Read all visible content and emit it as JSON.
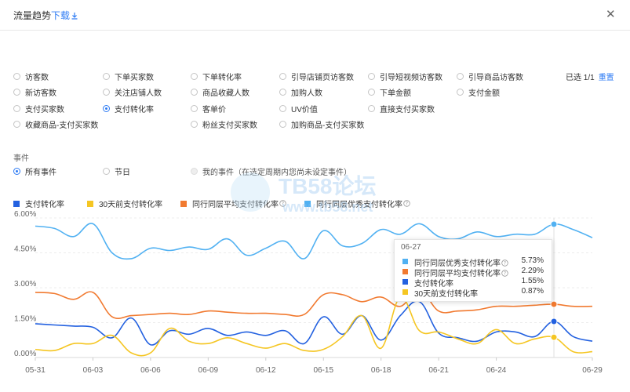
{
  "header": {
    "title": "流量趋势",
    "link": "下载",
    "download_icon": "download-icon",
    "close_icon": "close-icon"
  },
  "metrics": {
    "rows": [
      [
        {
          "label": "访客数",
          "checked": false
        },
        {
          "label": "下单买家数",
          "checked": false
        },
        {
          "label": "下单转化率",
          "checked": false
        },
        {
          "label": "引导店铺页访客数",
          "checked": false
        },
        {
          "label": "引导短视频访客数",
          "checked": false
        },
        {
          "label": "引导商品访客数",
          "checked": false
        }
      ],
      [
        {
          "label": "新访客数",
          "checked": false
        },
        {
          "label": "关注店铺人数",
          "checked": false
        },
        {
          "label": "商品收藏人数",
          "checked": false
        },
        {
          "label": "加购人数",
          "checked": false
        },
        {
          "label": "下单金额",
          "checked": false
        },
        {
          "label": "支付金额",
          "checked": false
        }
      ],
      [
        {
          "label": "支付买家数",
          "checked": false
        },
        {
          "label": "支付转化率",
          "checked": true
        },
        {
          "label": "客单价",
          "checked": false
        },
        {
          "label": "UV价值",
          "checked": false
        },
        {
          "label": "直接支付买家数",
          "checked": false
        }
      ],
      [
        {
          "label": "收藏商品-支付买家数",
          "checked": false
        },
        null,
        {
          "label": "粉丝支付买家数",
          "checked": false
        },
        {
          "label": "加购商品-支付买家数",
          "checked": false
        }
      ]
    ],
    "selected_text": "已选 1/1",
    "reset": "重置"
  },
  "events": {
    "title": "事件",
    "options": [
      {
        "label": "所有事件",
        "checked": true
      },
      {
        "label": "节日",
        "checked": false
      },
      {
        "label": "我的事件（在选定周期内您尚未设定事件）",
        "checked": false,
        "disabled": true
      }
    ]
  },
  "legend": [
    {
      "name": "支付转化率",
      "color": "#2361e0"
    },
    {
      "name": "30天前支付转化率",
      "color": "#f5c623"
    },
    {
      "name": "同行同层平均支付转化率",
      "color": "#f17a30",
      "help_icon": "help-icon"
    },
    {
      "name": "同行同层优秀支付转化率",
      "color": "#51b1f2",
      "help_icon": "help-icon"
    }
  ],
  "tooltip": {
    "date": "06-27",
    "rows": [
      {
        "name": "同行同层优秀支付转化率",
        "value": "5.73%",
        "color": "#51b1f2",
        "help_icon": "help-icon"
      },
      {
        "name": "同行同层平均支付转化率",
        "value": "2.29%",
        "color": "#f17a30",
        "help_icon": "help-icon"
      },
      {
        "name": "支付转化率",
        "value": "1.55%",
        "color": "#2361e0"
      },
      {
        "name": "30天前支付转化率",
        "value": "0.87%",
        "color": "#f5c623"
      }
    ]
  },
  "watermark": {
    "line1": "TB58论坛",
    "line2": "www.tb58.net"
  },
  "chart_data": {
    "type": "line",
    "ylim": [
      0,
      6
    ],
    "y_ticks": [
      "0.00%",
      "1.50%",
      "3.00%",
      "4.50%",
      "6.00%"
    ],
    "x_ticks": [
      {
        "label": "05-31",
        "index": 0
      },
      {
        "label": "06-03",
        "index": 3
      },
      {
        "label": "06-06",
        "index": 6
      },
      {
        "label": "06-09",
        "index": 9
      },
      {
        "label": "06-12",
        "index": 12
      },
      {
        "label": "06-15",
        "index": 15
      },
      {
        "label": "06-18",
        "index": 18
      },
      {
        "label": "06-21",
        "index": 21
      },
      {
        "label": "06-24",
        "index": 24
      },
      {
        "label": "06-29",
        "index": 29
      }
    ],
    "hover_index": 27,
    "x": [
      "05-31",
      "06-01",
      "06-02",
      "06-03",
      "06-04",
      "06-05",
      "06-06",
      "06-07",
      "06-08",
      "06-09",
      "06-10",
      "06-11",
      "06-12",
      "06-13",
      "06-14",
      "06-15",
      "06-16",
      "06-17",
      "06-18",
      "06-19",
      "06-20",
      "06-21",
      "06-22",
      "06-23",
      "06-24",
      "06-25",
      "06-26",
      "06-27",
      "06-28",
      "06-29"
    ],
    "series": [
      {
        "name": "同行同层优秀支付转化率",
        "color": "#51b1f2",
        "values": [
          5.65,
          5.55,
          5.2,
          5.75,
          4.5,
          4.25,
          4.7,
          4.6,
          4.75,
          4.65,
          5.1,
          4.4,
          4.7,
          5.0,
          4.25,
          5.45,
          4.8,
          4.9,
          5.5,
          5.3,
          5.75,
          5.2,
          5.1,
          5.4,
          5.2,
          5.3,
          5.3,
          5.73,
          5.5,
          5.15
        ]
      },
      {
        "name": "同行同层平均支付转化率",
        "color": "#f17a30",
        "values": [
          2.8,
          2.75,
          2.5,
          2.8,
          1.75,
          1.8,
          1.85,
          1.9,
          1.85,
          2.0,
          1.95,
          1.9,
          1.9,
          1.85,
          1.85,
          2.7,
          2.7,
          2.4,
          2.6,
          2.2,
          2.9,
          2.0,
          2.0,
          2.05,
          2.2,
          2.2,
          2.25,
          2.29,
          2.2,
          2.2
        ]
      },
      {
        "name": "支付转化率",
        "color": "#2361e0",
        "values": [
          1.45,
          1.4,
          1.35,
          1.3,
          0.85,
          1.7,
          0.55,
          1.15,
          1.0,
          1.25,
          0.95,
          1.1,
          0.95,
          1.15,
          0.6,
          1.75,
          1.0,
          1.8,
          0.75,
          1.8,
          2.4,
          1.05,
          0.85,
          0.7,
          1.1,
          1.1,
          0.9,
          1.55,
          0.9,
          0.7
        ]
      },
      {
        "name": "30天前支付转化率",
        "color": "#f5c623",
        "values": [
          0.35,
          0.3,
          0.6,
          0.6,
          0.95,
          0.2,
          0.2,
          1.25,
          0.7,
          0.6,
          0.85,
          0.6,
          0.4,
          0.6,
          0.3,
          0.35,
          0.9,
          1.8,
          0.4,
          2.6,
          1.15,
          1.1,
          0.8,
          0.6,
          1.2,
          0.6,
          0.8,
          0.87,
          0.25,
          0.25
        ]
      }
    ]
  }
}
